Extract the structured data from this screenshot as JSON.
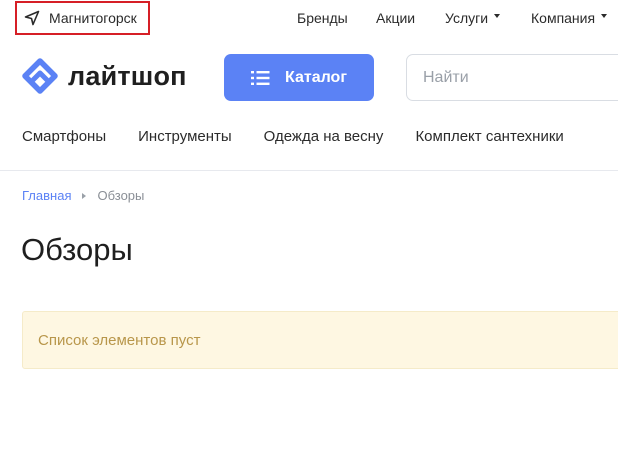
{
  "topbar": {
    "city": "Магнитогорск",
    "nav": [
      {
        "label": "Бренды",
        "dropdown": false
      },
      {
        "label": "Акции",
        "dropdown": false
      },
      {
        "label": "Услуги",
        "dropdown": true
      },
      {
        "label": "Компания",
        "dropdown": true
      }
    ]
  },
  "header": {
    "logo_text": "лайтшоп",
    "catalog_label": "Каталог",
    "search_placeholder": "Найти"
  },
  "categories": [
    "Смартфоны",
    "Инструменты",
    "Одежда на весну",
    "Комплект сантехники"
  ],
  "breadcrumb": {
    "home": "Главная",
    "current": "Обзоры"
  },
  "main": {
    "title": "Обзоры",
    "empty_message": "Список элементов пуст"
  },
  "colors": {
    "accent": "#5b82f5",
    "highlight_border": "#d61f26",
    "notice_bg": "#fef7e2",
    "notice_text": "#b8964a"
  },
  "icons": {
    "city": "navigation-arrow-icon",
    "logo": "logo-mark-icon",
    "catalog": "list-icon",
    "dropdown": "caret-down-icon"
  }
}
